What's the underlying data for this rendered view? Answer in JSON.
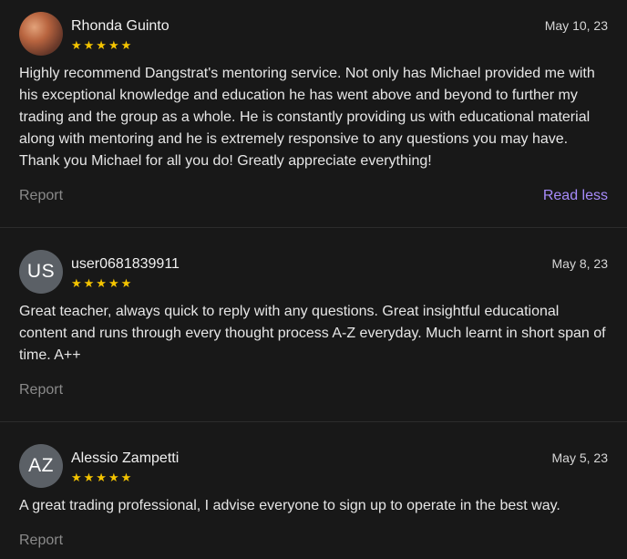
{
  "reviews": [
    {
      "avatar_type": "photo",
      "name": "Rhonda Guinto",
      "stars": "★★★★★",
      "rating": 5,
      "date": "May 10, 23",
      "text": "Highly recommend Dangstrat's mentoring service. Not only has Michael provided me with his exceptional knowledge and education he has went above and beyond to further my trading and the group as a whole. He is constantly providing us with educational material along with mentoring and he is extremely responsive to any questions you may have. Thank you Michael for all you do! Greatly appreciate everything!",
      "report_label": "Report",
      "read_less_label": "Read less"
    },
    {
      "avatar_type": "initials",
      "initials": "US",
      "name": "user0681839911",
      "stars": "★★★★★",
      "rating": 5,
      "date": "May 8, 23",
      "text": "Great teacher, always quick to reply with any questions. Great insightful educational content and runs through every thought process A-Z everyday. Much learnt in short span of time. A++",
      "report_label": "Report"
    },
    {
      "avatar_type": "initials",
      "initials": "AZ",
      "name": "Alessio Zampetti",
      "stars": "★★★★★",
      "rating": 5,
      "date": "May 5, 23",
      "text": "A great trading professional, I advise everyone to sign up to operate in the best way.",
      "report_label": "Report"
    }
  ],
  "colors": {
    "background": "#181818",
    "star": "#f4c400",
    "link_accent": "#a78bfa",
    "muted": "#8a8a8a"
  }
}
